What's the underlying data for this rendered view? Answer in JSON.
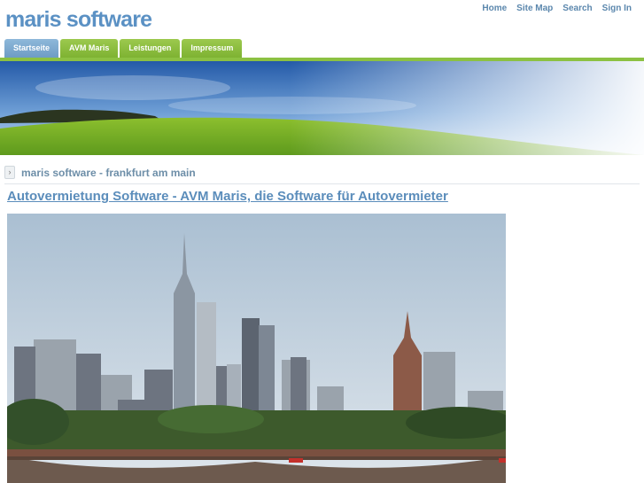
{
  "header": {
    "site_title": "maris software",
    "links": [
      "Home",
      "Site Map",
      "Search",
      "Sign In"
    ]
  },
  "nav": {
    "tabs": [
      "Startseite",
      "AVM Maris",
      "Leistungen",
      "Impressum"
    ],
    "active": "Startseite"
  },
  "breadcrumb": {
    "label": "maris software - frankfurt am main"
  },
  "article": {
    "title": "Autovermietung Software - AVM Maris, die Software für Autovermieter"
  },
  "colors": {
    "title_blue": "#5b91c4",
    "nav_green": "#8cc142",
    "active_tab": "#7aa8cf",
    "link_blue": "#5b8dbb"
  },
  "icons": {
    "breadcrumb": "chevron-right-icon"
  }
}
